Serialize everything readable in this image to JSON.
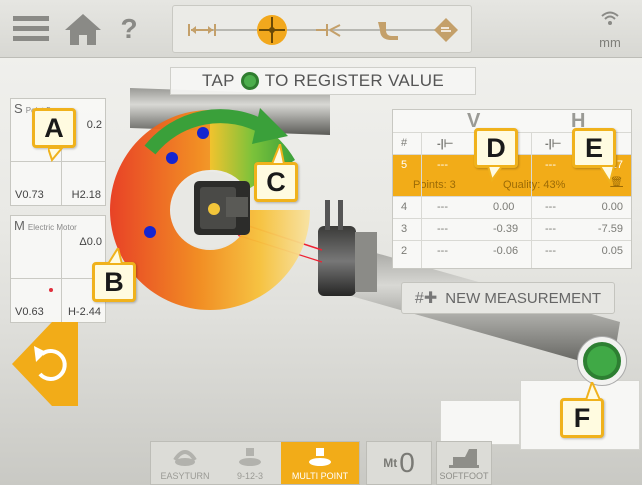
{
  "toolbar": {
    "menu_icon": "hamburger-icon",
    "home_icon": "home-icon",
    "help_label": "?",
    "steps": [
      {
        "name": "dimensions-step",
        "icon": "dimensions-icon",
        "active": false
      },
      {
        "name": "measure-step",
        "icon": "crosshair-icon",
        "active": true
      },
      {
        "name": "results-step",
        "icon": "results-icon",
        "active": false
      },
      {
        "name": "correct-step",
        "icon": "magnet-icon",
        "active": false
      },
      {
        "name": "report-step",
        "icon": "report-icon",
        "active": false
      }
    ],
    "unit": "mm",
    "connection_icon": "wifi-icon"
  },
  "banner": {
    "text_before": "TAP",
    "text_after": "TO REGISTER VALUE"
  },
  "sensor_s": {
    "title": "S",
    "subtitle": "Point 5",
    "value_top_right": "0.2",
    "v_value": "V0.73",
    "h_value": "H2.18"
  },
  "sensor_m": {
    "title": "M",
    "subtitle": "Electric Motor",
    "angle_value": "Δ0.0",
    "v_value": "V0.63",
    "h_value": "H-2.44"
  },
  "table": {
    "col_v": "V",
    "col_h": "H",
    "col_num": "#",
    "active_row": {
      "num": "5",
      "v_coupling": "---",
      "h_coupling": "---",
      "h_value": "0.17"
    },
    "points_label": "Points: 3",
    "quality_label": "Quality: 43%",
    "rows": [
      {
        "num": "4",
        "v_angle": "---",
        "v_value": "0.00",
        "h_angle": "---",
        "h_value": "0.00"
      },
      {
        "num": "3",
        "v_angle": "---",
        "v_value": "-0.39",
        "h_angle": "---",
        "h_value": "-7.59"
      },
      {
        "num": "2",
        "v_angle": "---",
        "v_value": "-0.06",
        "h_angle": "---",
        "h_value": "0.05"
      }
    ]
  },
  "new_measurement": "NEW MEASUREMENT",
  "callouts": {
    "a": "A",
    "b": "B",
    "c": "C",
    "d": "D",
    "e": "E",
    "f": "F"
  },
  "bottom_modes": [
    {
      "label": "EASYTURN",
      "icon": "easyturn-icon",
      "selected": false
    },
    {
      "label": "9-12-3",
      "icon": "clock-position-icon",
      "selected": false
    },
    {
      "label": "MULTI POINT",
      "icon": "multipoint-icon",
      "selected": true
    }
  ],
  "measurement_time": {
    "icon": "mt-icon",
    "value": "0"
  },
  "softfoot": {
    "label": "SOFTFOOT",
    "icon": "softfoot-icon"
  },
  "colors": {
    "accent": "#f2ac18",
    "register_green": "#40a946",
    "callout_border": "#f0b21c"
  }
}
